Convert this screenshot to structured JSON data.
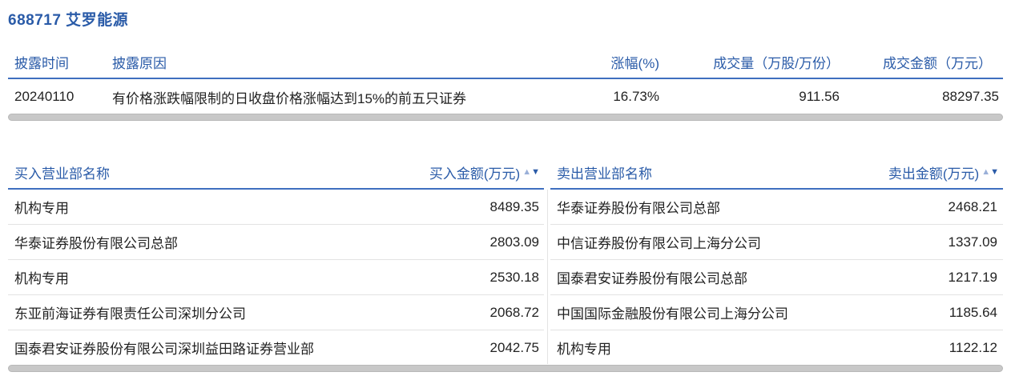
{
  "title": "688717 艾罗能源",
  "disclosure": {
    "headers": {
      "time": "披露时间",
      "reason": "披露原因",
      "change": "涨幅(%)",
      "volume": "成交量（万股/万份）",
      "amount": "成交金额（万元）"
    },
    "row": {
      "time": "20240110",
      "reason": "有价格涨跌幅限制的日收盘价格涨幅达到15%的前五只证券",
      "change": "16.73%",
      "volume": "911.56",
      "amount": "88297.35"
    }
  },
  "buy": {
    "header_name": "买入营业部名称",
    "header_amount": "买入金额(万元)",
    "rows": [
      {
        "name": "机构专用",
        "amount": "8489.35"
      },
      {
        "name": "华泰证券股份有限公司总部",
        "amount": "2803.09"
      },
      {
        "name": "机构专用",
        "amount": "2530.18"
      },
      {
        "name": "东亚前海证券有限责任公司深圳分公司",
        "amount": "2068.72"
      },
      {
        "name": "国泰君安证券股份有限公司深圳益田路证券营业部",
        "amount": "2042.75"
      }
    ]
  },
  "sell": {
    "header_name": "卖出营业部名称",
    "header_amount": "卖出金额(万元)",
    "rows": [
      {
        "name": "华泰证券股份有限公司总部",
        "amount": "2468.21"
      },
      {
        "name": "中信证券股份有限公司上海分公司",
        "amount": "1337.09"
      },
      {
        "name": "国泰君安证券股份有限公司总部",
        "amount": "1217.19"
      },
      {
        "name": "中国国际金融股份有限公司上海分公司",
        "amount": "1185.64"
      },
      {
        "name": "机构专用",
        "amount": "1122.12"
      }
    ]
  },
  "icons": {
    "sort_up": "▲",
    "sort_down": "▼"
  },
  "colors": {
    "accent": "#2a5ba8",
    "header_border": "#3f6fbf"
  }
}
